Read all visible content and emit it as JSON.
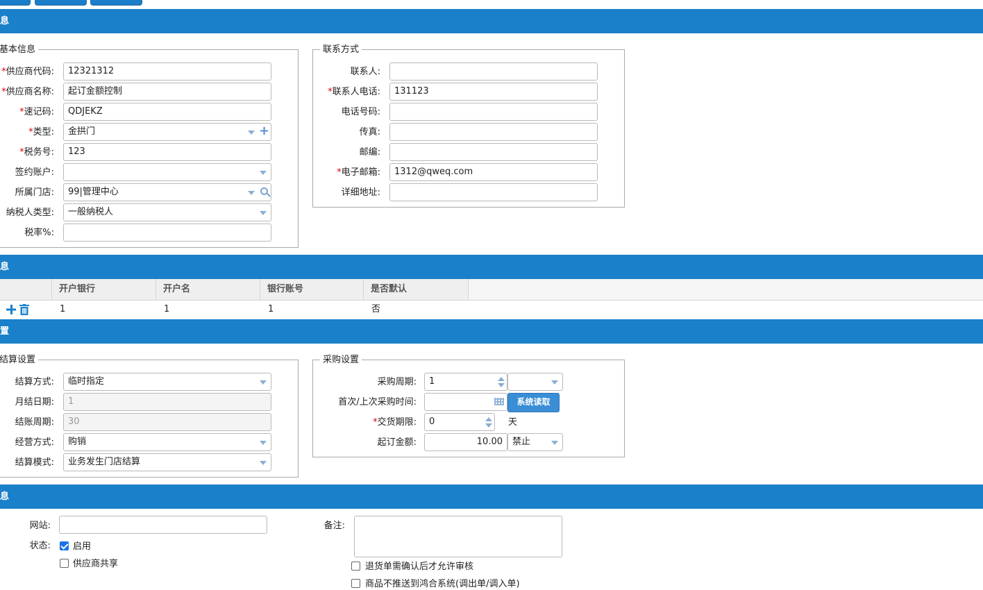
{
  "sections": {
    "info1": "信息",
    "bank": "信息",
    "settings": "设置",
    "info2": "信息"
  },
  "basic": {
    "legend": "基本信息",
    "fields": [
      {
        "label": "供应商代码:",
        "required": "*",
        "value": "12321312"
      },
      {
        "label": "供应商名称:",
        "required": "*",
        "value": "起订金额控制"
      },
      {
        "label": "速记码:",
        "required": "*",
        "value": "QDJEKZ"
      },
      {
        "label": "类型:",
        "required": "*",
        "value": "金拱门"
      },
      {
        "label": "税务号:",
        "required": "*",
        "value": "123"
      },
      {
        "label": "签约账户:",
        "required": "",
        "value": ""
      },
      {
        "label": "所属门店:",
        "required": "",
        "value": "99|管理中心"
      },
      {
        "label": "纳税人类型:",
        "required": "",
        "value": "一般纳税人"
      },
      {
        "label": "税率%:",
        "required": "",
        "value": ""
      }
    ]
  },
  "contact": {
    "legend": "联系方式",
    "fields": [
      {
        "label": "联系人:",
        "required": "",
        "value": ""
      },
      {
        "label": "联系人电话:",
        "required": "*",
        "value": "131123"
      },
      {
        "label": "电话号码:",
        "required": "",
        "value": ""
      },
      {
        "label": "传真:",
        "required": "",
        "value": ""
      },
      {
        "label": "邮编:",
        "required": "",
        "value": ""
      },
      {
        "label": "电子邮箱:",
        "required": "*",
        "value": "1312@qweq.com"
      },
      {
        "label": "详细地址:",
        "required": "",
        "value": ""
      }
    ]
  },
  "bank_table": {
    "columns": [
      "开户银行",
      "开户名",
      "银行账号",
      "是否默认"
    ],
    "rows": [
      [
        "1",
        "1",
        "1",
        "否"
      ]
    ]
  },
  "settle": {
    "legend": "结算设置",
    "fields": [
      {
        "label": "结算方式:",
        "value": "临时指定"
      },
      {
        "label": "月结日期:",
        "value": "1"
      },
      {
        "label": "结账周期:",
        "value": "30"
      },
      {
        "label": "经营方式:",
        "value": "购销"
      },
      {
        "label": "结算模式:",
        "value": "业务发生门店结算"
      }
    ]
  },
  "purchase": {
    "legend": "采购设置",
    "cycle_label": "采购周期:",
    "cycle_value": "1",
    "cycle_unit": "",
    "time_label": "首次/上次采购时间:",
    "time_value": "",
    "read_button": "系统读取",
    "delivery_required": "*",
    "delivery_label": "交货期限:",
    "delivery_value": "0",
    "delivery_unit": "天",
    "min_amount_label": "起订金额:",
    "min_amount_value": "10.00",
    "min_amount_mode": "禁止"
  },
  "other": {
    "website_label": "网站:",
    "website_value": "",
    "status_label": "状态:",
    "enable_label": "启用",
    "enable_checked": true,
    "share_label": "供应商共享",
    "share_checked": false,
    "remark_label": "备注:",
    "remark_value": "",
    "return_confirm_label": "退货单需确认后才允许审核",
    "partial_label": "商品不推送到鸿合系统(调出单/调入单)"
  }
}
